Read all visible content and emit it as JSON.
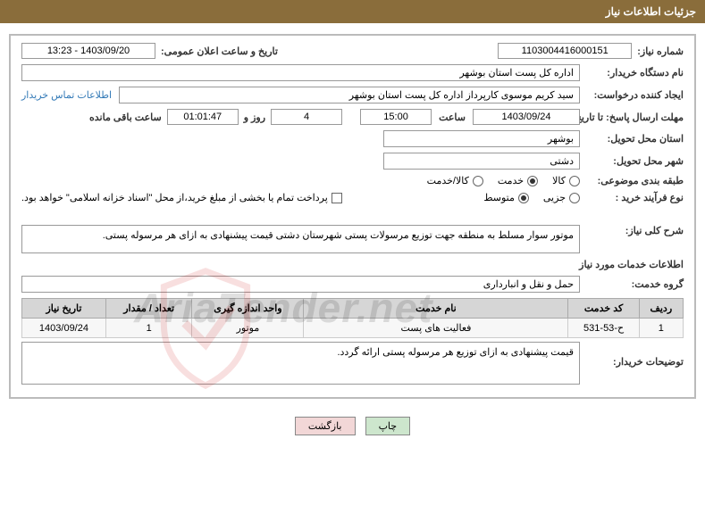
{
  "header": {
    "title": "جزئیات اطلاعات نیاز"
  },
  "fields": {
    "need_no_label": "شماره نیاز:",
    "need_no": "1103004416000151",
    "announce_date_label": "تاریخ و ساعت اعلان عمومی:",
    "announce_date": "1403/09/20 - 13:23",
    "buyer_org_label": "نام دستگاه خریدار:",
    "buyer_org": "اداره کل پست استان بوشهر",
    "creator_label": "ایجاد کننده درخواست:",
    "creator": "سید کریم موسوی کارپرداز اداره کل پست استان بوشهر",
    "contact_link": "اطلاعات تماس خریدار",
    "deadline_label": "مهلت ارسال پاسخ: تا تاریخ:",
    "deadline_date": "1403/09/24",
    "time_label": "ساعت",
    "deadline_time": "15:00",
    "days_remaining": "4",
    "days_and": "روز و",
    "time_remaining": "01:01:47",
    "remaining_label": "ساعت باقی مانده",
    "province_label": "استان محل تحویل:",
    "province": "بوشهر",
    "city_label": "شهر محل تحویل:",
    "city": "دشتی",
    "category_label": "طبقه بندی موضوعی:",
    "cat_goods": "کالا",
    "cat_service": "خدمت",
    "cat_both": "کالا/خدمت",
    "purchase_type_label": "نوع فرآیند خرید :",
    "type_minor": "جزیی",
    "type_medium": "متوسط",
    "treasury_label": "پرداخت تمام یا بخشی از مبلغ خرید،از محل \"اسناد خزانه اسلامی\" خواهد بود.",
    "desc_label": "شرح کلی نیاز:",
    "desc": "موتور سوار مسلط به منطقه جهت توزیع مرسولات پستی شهرستان دشتی قیمت پیشنهادی به ازای هر مرسوله پستی.",
    "service_info_label": "اطلاعات خدمات مورد نیاز",
    "service_group_label": "گروه خدمت:",
    "service_group": "حمل و نقل و انبارداری",
    "buyer_notes_label": "توضیحات خریدار:",
    "buyer_notes": "قیمت پیشنهادی به ازای توزیع هر مرسوله پستی ارائه گردد."
  },
  "table": {
    "headers": {
      "row": "ردیف",
      "code": "کد خدمت",
      "name": "نام خدمت",
      "unit": "واحد اندازه گیری",
      "qty": "تعداد / مقدار",
      "date": "تاریخ نیاز"
    },
    "rows": [
      {
        "row": "1",
        "code": "ح-53-531",
        "name": "فعالیت های پست",
        "unit": "موتور",
        "qty": "1",
        "date": "1403/09/24"
      }
    ]
  },
  "buttons": {
    "print": "چاپ",
    "back": "بازگشت"
  },
  "watermark": "AriaTender.net"
}
